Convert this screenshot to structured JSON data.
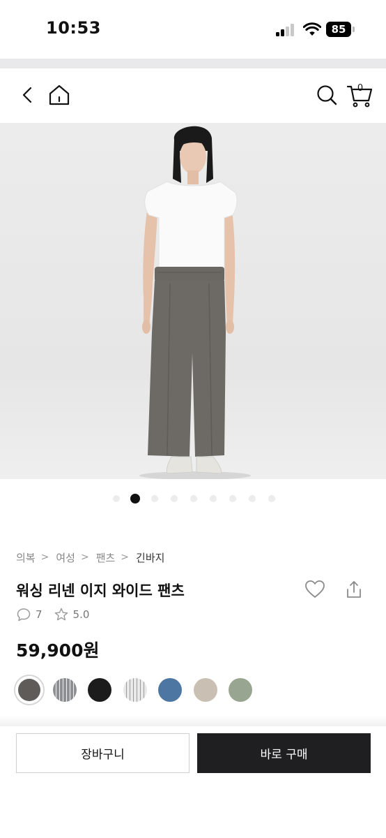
{
  "status_bar": {
    "time": "10:53",
    "battery_level": "85",
    "icons": [
      "signal-icon",
      "wifi-icon",
      "battery-icon"
    ]
  },
  "nav": {
    "icons": [
      "back-arrow-icon",
      "home-icon",
      "search-icon",
      "cart-icon"
    ],
    "cart_count": "0"
  },
  "hero": {
    "image_description_icon": "product-photo",
    "carousel": {
      "total": 9,
      "active": 2
    }
  },
  "product": {
    "breadcrumb": [
      "의복",
      "여성",
      "팬츠",
      "긴바지"
    ],
    "title": "워싱 리넨 이지 와이드 팬츠",
    "review_count": "7",
    "rating": "5.0",
    "price": "59,900원",
    "color_swatches": [
      {
        "color": "#5e5b58",
        "selected": true
      },
      {
        "color": "#8d8f93",
        "pattern": "stripe",
        "selected": false
      },
      {
        "color": "#1c1c1c",
        "selected": false
      },
      {
        "color": "#e9e9ea",
        "pattern": "stripe",
        "selected": false
      },
      {
        "color": "#4d76a3",
        "selected": false
      },
      {
        "color": "#c9c0b3",
        "selected": false
      },
      {
        "color": "#98a590",
        "selected": false
      }
    ]
  },
  "actions": {
    "cart_label": "장바구니",
    "buy_label": "바로 구매"
  }
}
